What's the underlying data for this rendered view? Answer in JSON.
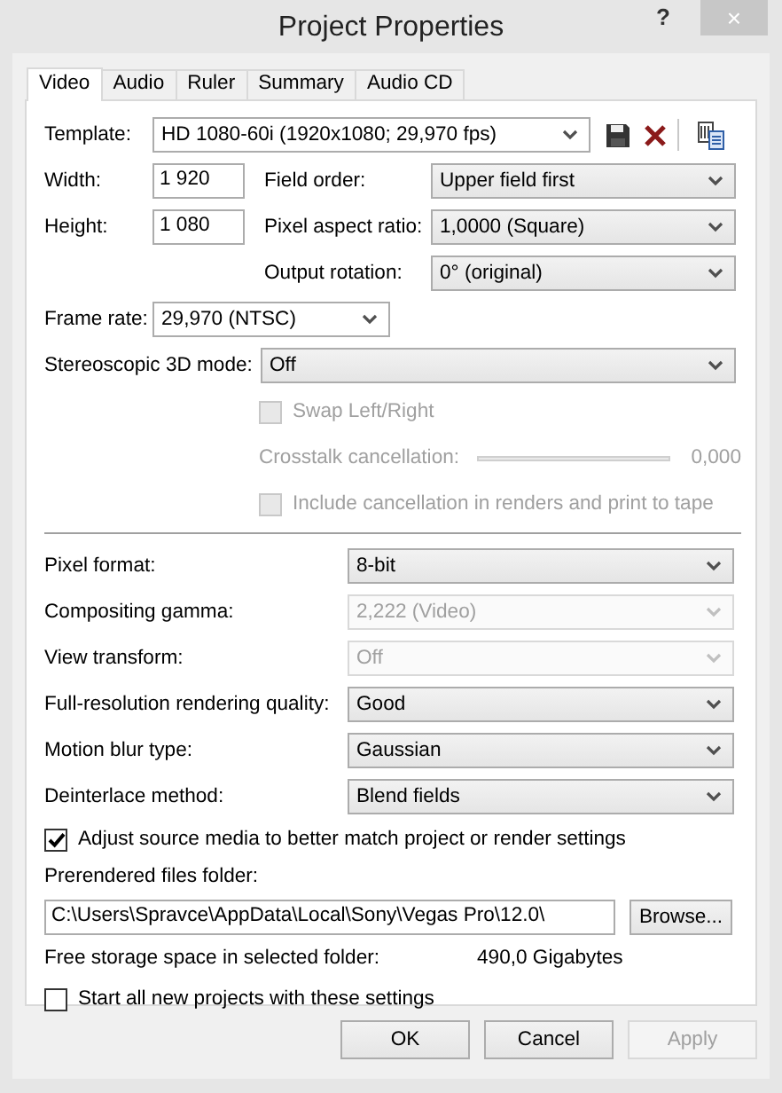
{
  "window": {
    "title": "Project Properties",
    "help": "?",
    "close": "×"
  },
  "tabs": [
    {
      "label": "Video",
      "selected": true
    },
    {
      "label": "Audio",
      "selected": false
    },
    {
      "label": "Ruler",
      "selected": false
    },
    {
      "label": "Summary",
      "selected": false
    },
    {
      "label": "Audio CD",
      "selected": false
    }
  ],
  "template": {
    "label": "Template:",
    "value": "HD 1080-60i (1920x1080; 29,970 fps)"
  },
  "width": {
    "label": "Width:",
    "value": "1 920"
  },
  "field_order": {
    "label": "Field order:",
    "value": "Upper field first"
  },
  "height": {
    "label": "Height:",
    "value": "1 080"
  },
  "pixel_aspect_ratio": {
    "label": "Pixel aspect ratio:",
    "value": "1,0000 (Square)"
  },
  "output_rotation": {
    "label": "Output rotation:",
    "value": "0° (original)"
  },
  "frame_rate": {
    "label": "Frame rate:",
    "value": "29,970 (NTSC)"
  },
  "stereoscopic_3d_mode": {
    "label": "Stereoscopic 3D mode:",
    "value": "Off"
  },
  "swap_left_right": {
    "label": "Swap Left/Right",
    "checked": false,
    "disabled": true
  },
  "crosstalk_cancellation": {
    "label": "Crosstalk cancellation:",
    "reading": "0,000",
    "disabled": true
  },
  "include_cancellation": {
    "label": "Include cancellation in renders and print to tape",
    "checked": false,
    "disabled": true
  },
  "settings": [
    {
      "label": "Pixel format:",
      "value": "8-bit",
      "disabled": false
    },
    {
      "label": "Compositing gamma:",
      "value": "2,222 (Video)",
      "disabled": true
    },
    {
      "label": "View transform:",
      "value": "Off",
      "disabled": true
    },
    {
      "label": "Full-resolution rendering quality:",
      "value": "Good",
      "disabled": false
    },
    {
      "label": "Motion blur type:",
      "value": "Gaussian",
      "disabled": false
    },
    {
      "label": "Deinterlace method:",
      "value": "Blend fields",
      "disabled": false
    }
  ],
  "adjust_source_media": {
    "label": "Adjust source media to better match project or render settings",
    "checked": true,
    "disabled": false
  },
  "prerendered_files_folder": {
    "label": "Prerendered files folder:",
    "value": "C:\\Users\\Spravce\\AppData\\Local\\Sony\\Vegas Pro\\12.0\\",
    "button": "Browse..."
  },
  "free_storage": {
    "label": "Free storage space in selected folder:",
    "value": "490,0 Gigabytes"
  },
  "start_new_projects": {
    "label": "Start all new projects with these settings",
    "checked": false,
    "disabled": false
  },
  "buttons": [
    {
      "label": "OK",
      "disabled": false
    },
    {
      "label": "Cancel",
      "disabled": false
    },
    {
      "label": "Apply",
      "disabled": true
    }
  ]
}
